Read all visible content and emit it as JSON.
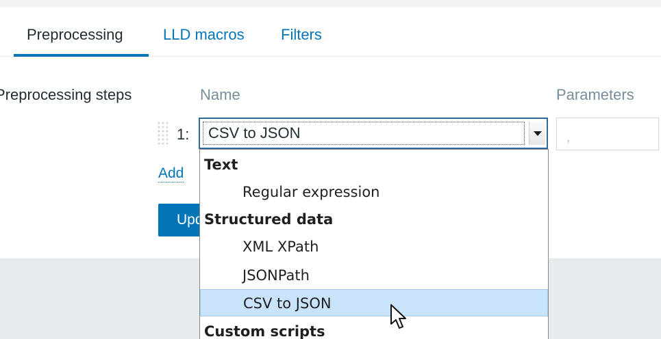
{
  "tabs": [
    {
      "label": "Preprocessing",
      "active": true
    },
    {
      "label": "LLD macros",
      "active": false
    },
    {
      "label": "Filters",
      "active": false
    }
  ],
  "section": {
    "label": "Preprocessing steps"
  },
  "columns": {
    "name": "Name",
    "parameters": "Parameters"
  },
  "step": {
    "number": "1:",
    "selected": "CSV to JSON",
    "param_value": ","
  },
  "actions": {
    "add_label": "Add",
    "update_label": "Update"
  },
  "dropdown": {
    "groups": [
      {
        "label": "Text",
        "options": [
          "Regular expression"
        ]
      },
      {
        "label": "Structured data",
        "options": [
          "XML XPath",
          "JSONPath",
          "CSV to JSON"
        ]
      },
      {
        "label": "Custom scripts",
        "options": []
      }
    ],
    "highlighted": "CSV to JSON"
  },
  "colors": {
    "accent": "#0275b8",
    "highlight": "#c9e4fa"
  }
}
